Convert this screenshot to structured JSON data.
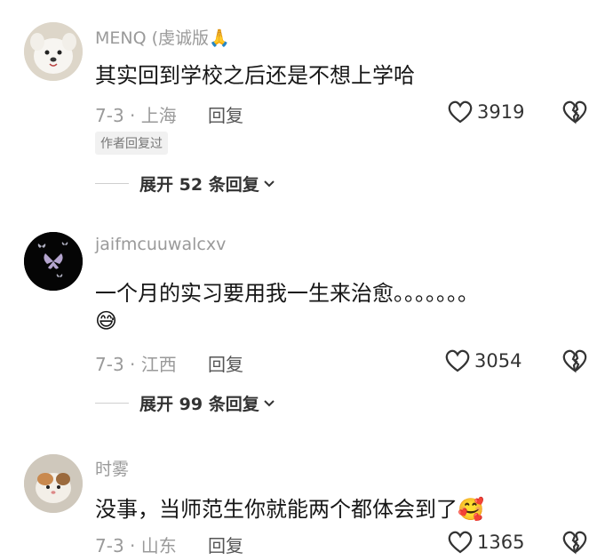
{
  "comments": [
    {
      "username": "MENQ (虔诚版",
      "username_emoji": "🙏",
      "text": "其实回到学校之后还是不想上学哈",
      "date_loc": "7-3 · 上海",
      "reply_label": "回复",
      "likes": "3919",
      "badge": "作者回复过",
      "expand": {
        "prefix": "展开",
        "count": "52",
        "suffix": "条回复"
      }
    },
    {
      "username": "jaifmcuuwalcxv",
      "text": "一个月的实习要用我一生来治愈。。。。。。。",
      "emoji_line": "😅",
      "date_loc": "7-3 · 江西",
      "reply_label": "回复",
      "likes": "3054",
      "expand": {
        "prefix": "展开",
        "count": "99",
        "suffix": "条回复"
      }
    },
    {
      "username": "时雾",
      "text": "没事，当师范生你就能两个都体会到了",
      "text_emoji": "🥰",
      "date_loc": "7-3 · 山东",
      "reply_label": "回复",
      "likes": "1365"
    }
  ],
  "icons": {
    "like": "heart-outline-icon",
    "dislike": "broken-heart-icon",
    "expand": "chevron-down-icon"
  },
  "colors": {
    "text_primary": "#161616",
    "text_secondary": "#9a9a9a",
    "background": "#ffffff"
  }
}
